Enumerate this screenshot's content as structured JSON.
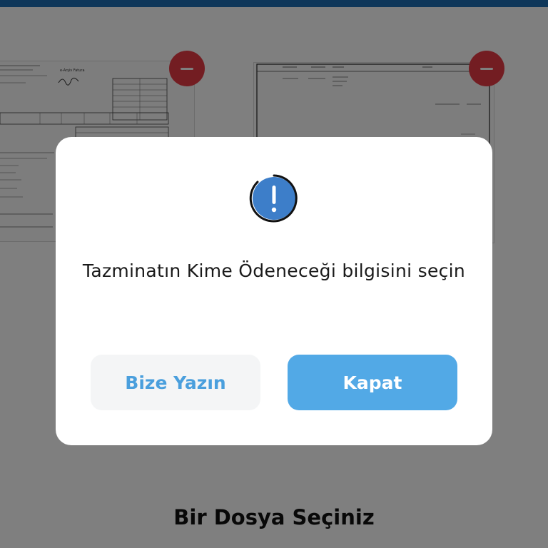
{
  "colors": {
    "top_bar": "#1f6fb5",
    "remove_button": "#e63a45",
    "primary_button": "#52a9e6",
    "secondary_button_text": "#4a9fdd",
    "alert_icon": "#3d7ec9"
  },
  "documents": [
    {
      "icon": "document-thumbnail",
      "remove_icon": "minus-icon"
    },
    {
      "icon": "document-thumbnail",
      "remove_icon": "minus-icon"
    }
  ],
  "page": {
    "heading": "Bir Dosya Seçiniz"
  },
  "modal": {
    "icon": "exclamation-circle-icon",
    "message": "Tazminatın Kime Ödeneceği bilgisini seçin",
    "secondary_button": "Bize Yazın",
    "primary_button": "Kapat"
  }
}
